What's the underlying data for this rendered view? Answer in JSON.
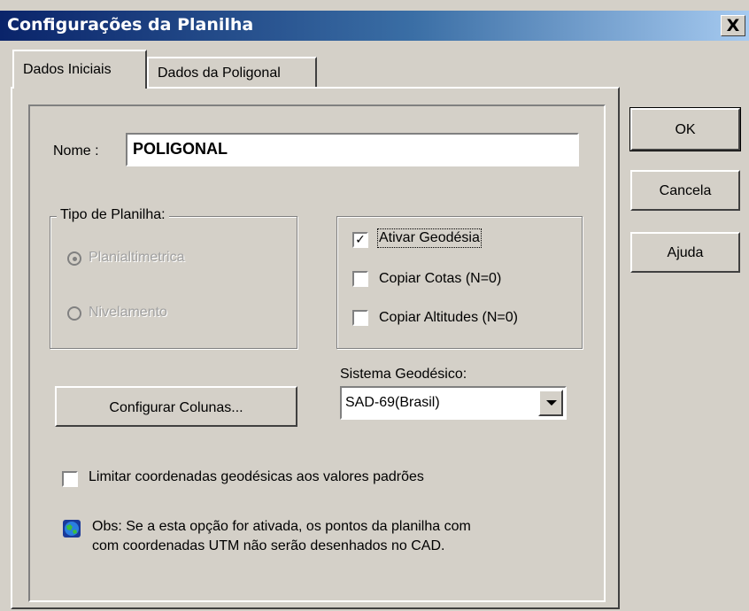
{
  "window": {
    "title": "Configurações da Planilha",
    "close_label": "X"
  },
  "tabs": [
    {
      "label": "Dados Iniciais",
      "active": true
    },
    {
      "label": "Dados da Poligonal",
      "active": false
    }
  ],
  "name": {
    "label": "Nome :",
    "value": "POLIGONAL"
  },
  "tipo_planilha": {
    "legend": "Tipo de Planilha:",
    "options": [
      {
        "label": "Planialtimetrica",
        "checked": true,
        "disabled": true
      },
      {
        "label": "Nivelamento",
        "checked": false,
        "disabled": true
      }
    ]
  },
  "options": [
    {
      "label": "Ativar Geodésia",
      "checked": true
    },
    {
      "label": "Copiar Cotas (N=0)",
      "checked": false
    },
    {
      "label": "Copiar Altitudes (N=0)",
      "checked": false
    }
  ],
  "configurar_button": "Configurar Colunas...",
  "sistema": {
    "label": "Sistema Geodésico:",
    "selected": "SAD-69(Brasil)"
  },
  "limitar": {
    "label": "Limitar coordenadas geodésicas aos valores padrões",
    "checked": false
  },
  "note": {
    "line1": "Obs: Se a esta opção for ativada, os pontos da planilha com",
    "line2": "com coordenadas UTM não serão desenhados no CAD."
  },
  "buttons": {
    "ok": "OK",
    "cancel": "Cancela",
    "help": "Ajuda"
  },
  "colors": {
    "titlebar_start": "#0a246a",
    "titlebar_end": "#a6caf0",
    "face": "#d4d0c8"
  }
}
